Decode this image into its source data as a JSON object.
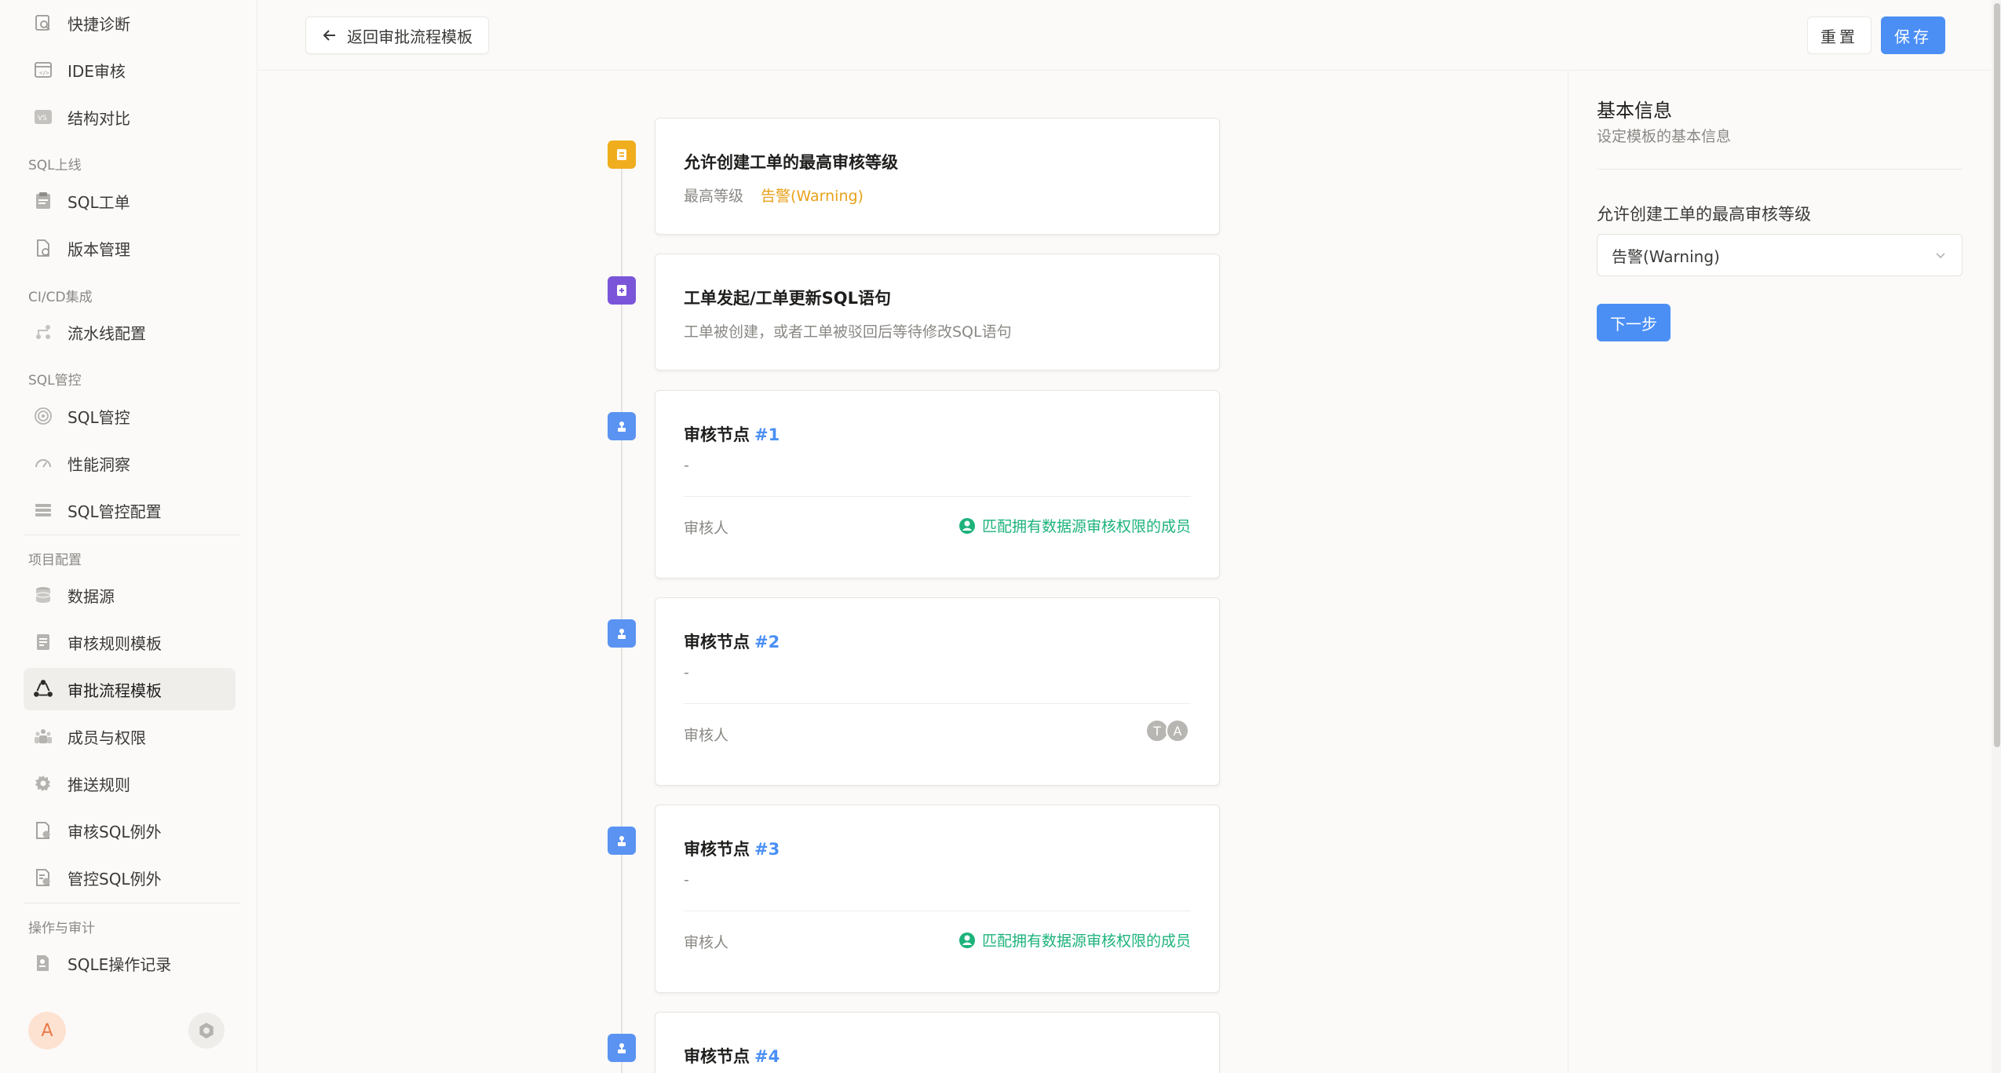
{
  "sidebar": {
    "items": [
      {
        "label": "快捷诊断",
        "icon": "diagnosis-icon"
      },
      {
        "label": "IDE审核",
        "icon": "ide-icon"
      },
      {
        "label": "结构对比",
        "icon": "vs-compare-icon"
      },
      {
        "label": "SQL工单",
        "icon": "clipboard-icon"
      },
      {
        "label": "版本管理",
        "icon": "version-file-icon"
      },
      {
        "label": "流水线配置",
        "icon": "pipeline-icon"
      },
      {
        "label": "SQL管控",
        "icon": "fingerprint-icon"
      },
      {
        "label": "性能洞察",
        "icon": "gauge-icon"
      },
      {
        "label": "SQL管控配置",
        "icon": "layers-icon"
      },
      {
        "label": "数据源",
        "icon": "database-icon"
      },
      {
        "label": "审核规则模板",
        "icon": "rule-template-icon"
      },
      {
        "label": "审批流程模板",
        "icon": "workflow-icon"
      },
      {
        "label": "成员与权限",
        "icon": "members-icon"
      },
      {
        "label": "推送规则",
        "icon": "gear-icon"
      },
      {
        "label": "审核SQL例外",
        "icon": "audit-exception-icon"
      },
      {
        "label": "管控SQL例外",
        "icon": "control-exception-icon"
      },
      {
        "label": "SQLE操作记录",
        "icon": "operation-record-icon"
      }
    ],
    "groups": {
      "sql_online": "SQL上线",
      "cicd": "CI/CD集成",
      "sql_control": "SQL管控",
      "project_config": "项目配置",
      "ops_audit": "操作与审计"
    },
    "user_avatar": "A"
  },
  "header": {
    "back_label": "返回审批流程模板",
    "reset_label": "重置",
    "save_label": "保存"
  },
  "timeline": {
    "level_card": {
      "title": "允许创建工单的最高审核等级",
      "level_label": "最高等级",
      "level_value": "告警(Warning)"
    },
    "submit_card": {
      "title": "工单发起/工单更新SQL语句",
      "desc": "工单被创建，或者工单被驳回后等待修改SQL语句"
    },
    "node_title": "审核节点",
    "nodes": [
      {
        "num": "#1",
        "desc": "-",
        "reviewer_label": "审核人",
        "reviewer_value": "匹配拥有数据源审核权限的成员"
      },
      {
        "num": "#2",
        "desc": "-",
        "reviewer_label": "审核人",
        "reviewers": [
          "T",
          "A"
        ]
      },
      {
        "num": "#3",
        "desc": "-",
        "reviewer_label": "审核人",
        "reviewer_value": "匹配拥有数据源审核权限的成员"
      },
      {
        "num": "#4"
      }
    ]
  },
  "panel": {
    "title": "基本信息",
    "subtitle": "设定模板的基本信息",
    "field_label": "允许创建工单的最高审核等级",
    "field_value": "告警(Warning)",
    "next_label": "下一步"
  },
  "colors": {
    "primary": "#4b8ff5",
    "warning": "#e8a21a",
    "success": "#1db37b",
    "submit_icon": "#7b55d9"
  }
}
